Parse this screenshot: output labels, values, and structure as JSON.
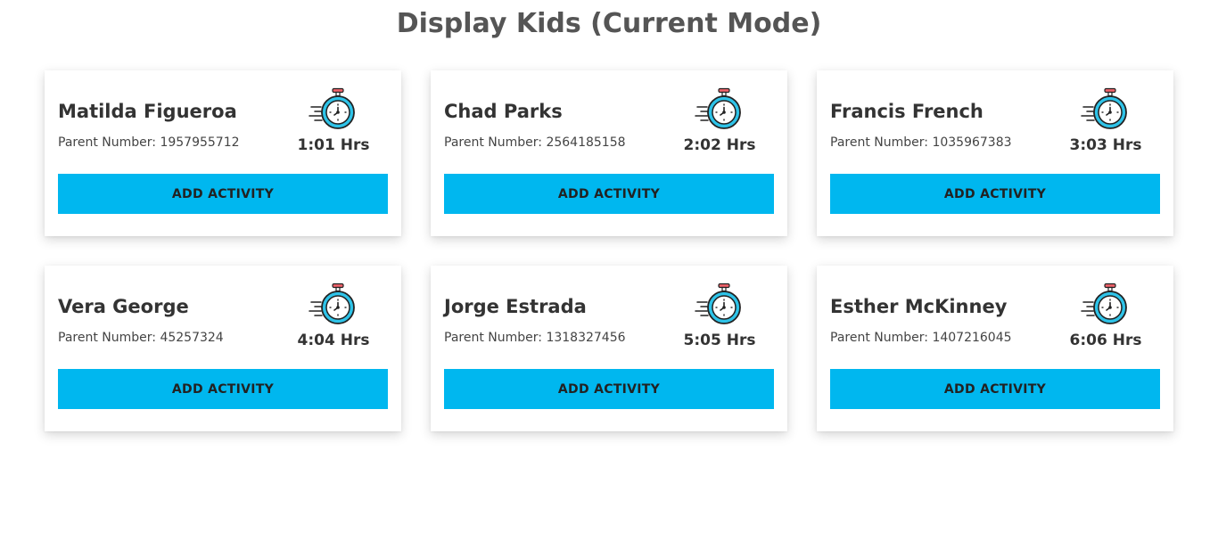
{
  "page": {
    "title": "Display Kids (Current Mode)"
  },
  "theme": {
    "button_color": "#00b7ef",
    "title_color": "#555555"
  },
  "kids": [
    {
      "name": "Matilda Figueroa",
      "parent_label": "Parent Number:",
      "parent_number": "1957955712",
      "hours": "1:01 Hrs",
      "button_label": "ADD ACTIVITY",
      "icon": "stopwatch-icon"
    },
    {
      "name": "Chad Parks",
      "parent_label": "Parent Number:",
      "parent_number": "2564185158",
      "hours": "2:02 Hrs",
      "button_label": "ADD ACTIVITY",
      "icon": "stopwatch-icon"
    },
    {
      "name": "Francis French",
      "parent_label": "Parent Number:",
      "parent_number": "1035967383",
      "hours": "3:03 Hrs",
      "button_label": "ADD ACTIVITY",
      "icon": "stopwatch-icon"
    },
    {
      "name": "Vera George",
      "parent_label": "Parent Number:",
      "parent_number": "45257324",
      "hours": "4:04 Hrs",
      "button_label": "ADD ACTIVITY",
      "icon": "stopwatch-icon"
    },
    {
      "name": "Jorge Estrada",
      "parent_label": "Parent Number:",
      "parent_number": "1318327456",
      "hours": "5:05 Hrs",
      "button_label": "ADD ACTIVITY",
      "icon": "stopwatch-icon"
    },
    {
      "name": "Esther McKinney",
      "parent_label": "Parent Number:",
      "parent_number": "1407216045",
      "hours": "6:06 Hrs",
      "button_label": "ADD ACTIVITY",
      "icon": "stopwatch-icon"
    }
  ]
}
